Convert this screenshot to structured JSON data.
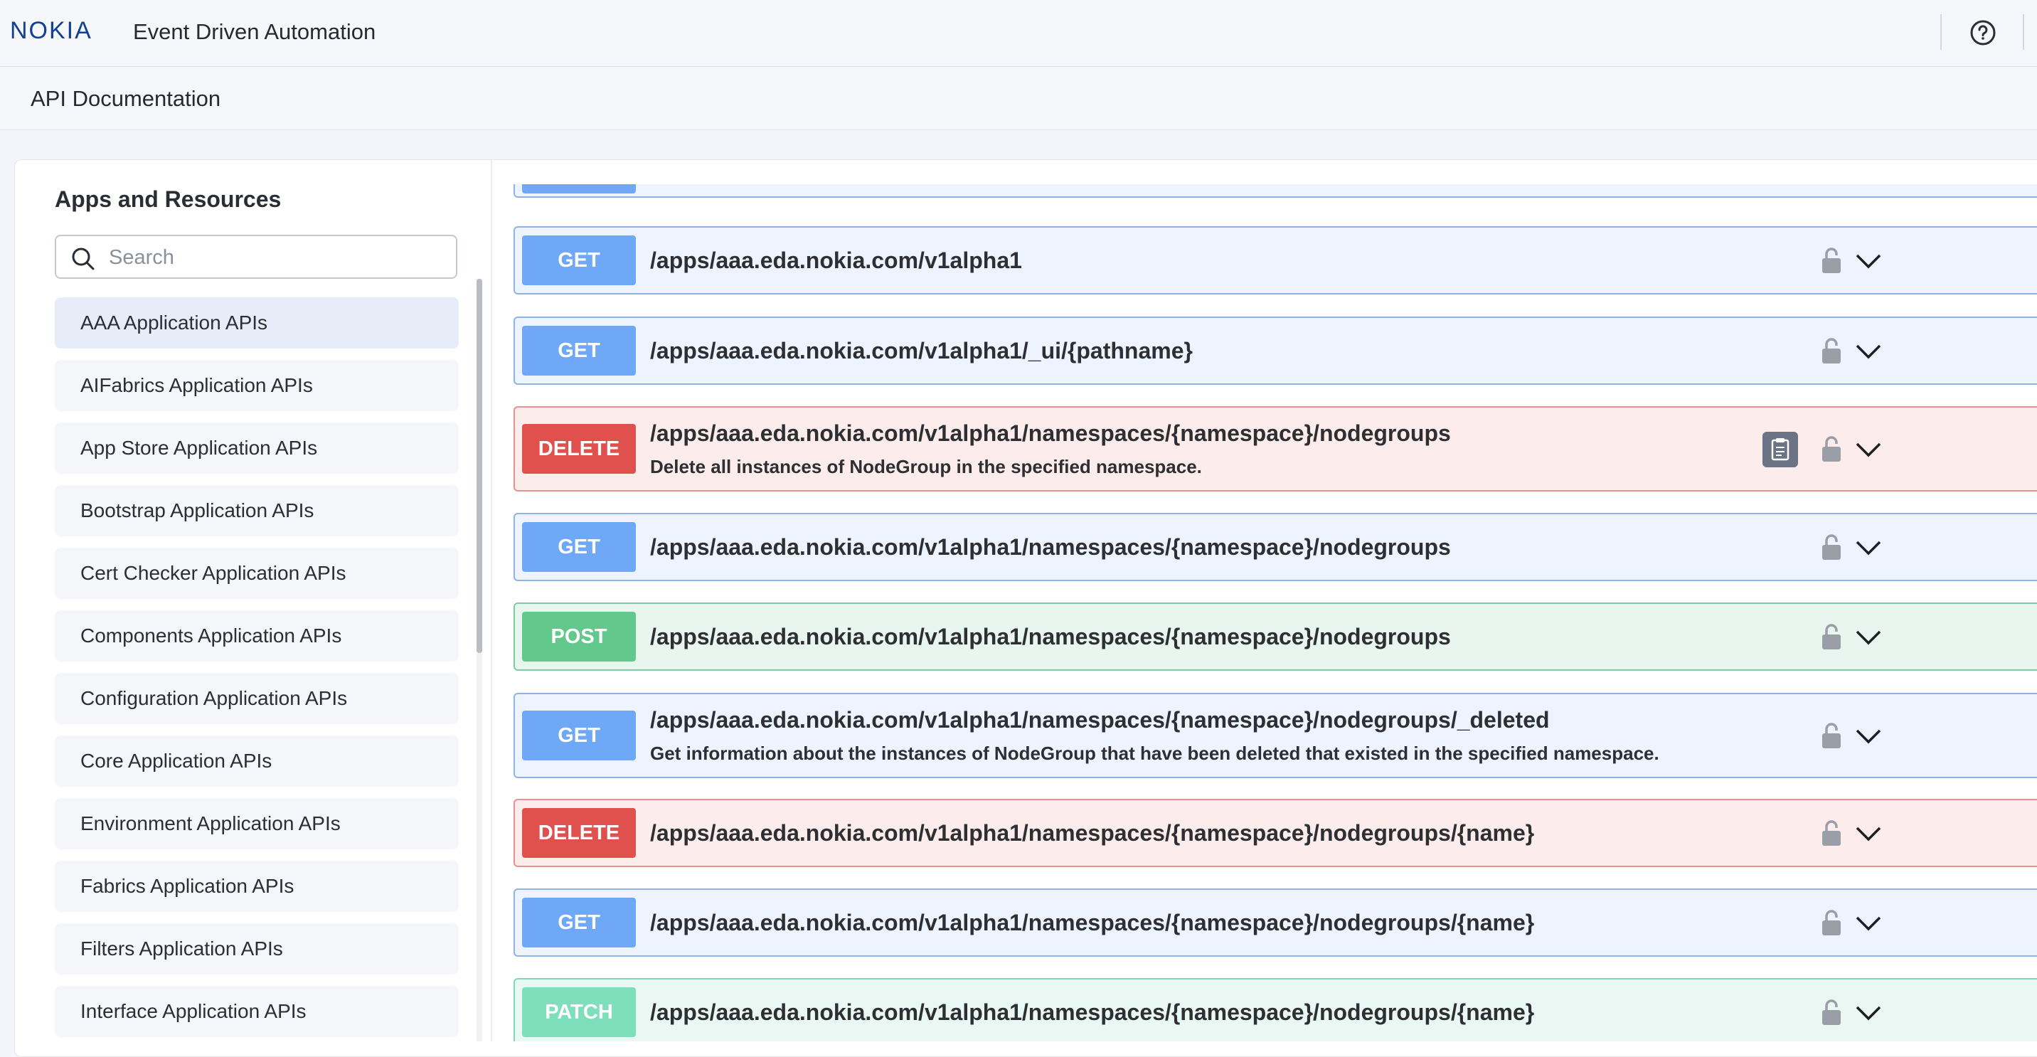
{
  "header": {
    "brand": "NOKIA",
    "app_title": "Event Driven Automation",
    "help_icon": "help-circle-icon"
  },
  "page": {
    "title": "API Documentation"
  },
  "sidebar": {
    "heading": "Apps and Resources",
    "search_placeholder": "Search",
    "items": [
      {
        "label": "AAA Application APIs",
        "active": true
      },
      {
        "label": "AIFabrics Application APIs"
      },
      {
        "label": "App Store Application APIs"
      },
      {
        "label": "Bootstrap Application APIs"
      },
      {
        "label": "Cert Checker Application APIs"
      },
      {
        "label": "Components Application APIs"
      },
      {
        "label": "Configuration Application APIs"
      },
      {
        "label": "Core Application APIs"
      },
      {
        "label": "Environment Application APIs"
      },
      {
        "label": "Fabrics Application APIs"
      },
      {
        "label": "Filters Application APIs"
      },
      {
        "label": "Interface Application APIs"
      }
    ]
  },
  "operations": [
    {
      "method": "GET",
      "path": "/apps/aaa.eda.nokia.com/v1alpha1"
    },
    {
      "method": "GET",
      "path": "/apps/aaa.eda.nokia.com/v1alpha1/_ui/{pathname}"
    },
    {
      "method": "DELETE",
      "path": "/apps/aaa.eda.nokia.com/v1alpha1/namespaces/{namespace}/nodegroups",
      "description": "Delete all instances of NodeGroup in the specified namespace."
    },
    {
      "method": "GET",
      "path": "/apps/aaa.eda.nokia.com/v1alpha1/namespaces/{namespace}/nodegroups"
    },
    {
      "method": "POST",
      "path": "/apps/aaa.eda.nokia.com/v1alpha1/namespaces/{namespace}/nodegroups"
    },
    {
      "method": "GET",
      "path": "/apps/aaa.eda.nokia.com/v1alpha1/namespaces/{namespace}/nodegroups/_deleted",
      "description": "Get information about the instances of NodeGroup that have been deleted that existed in the specified namespace."
    },
    {
      "method": "DELETE",
      "path": "/apps/aaa.eda.nokia.com/v1alpha1/namespaces/{namespace}/nodegroups/{name}"
    },
    {
      "method": "GET",
      "path": "/apps/aaa.eda.nokia.com/v1alpha1/namespaces/{namespace}/nodegroups/{name}"
    },
    {
      "method": "PATCH",
      "path": "/apps/aaa.eda.nokia.com/v1alpha1/namespaces/{namespace}/nodegroups/{name}"
    }
  ],
  "colors": {
    "get": "#6ea8f6",
    "delete": "#e0514d",
    "post": "#62c88b",
    "patch": "#7ddfbb",
    "brand": "#124191"
  }
}
